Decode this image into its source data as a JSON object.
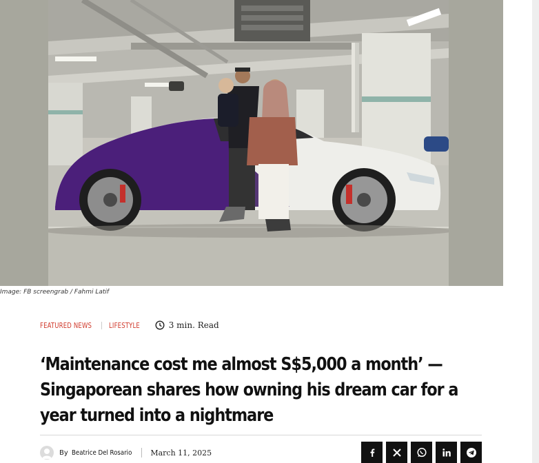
{
  "caption": "Image: FB screengrab / Fahmi Latif",
  "categories": [
    {
      "label": "FEATURED NEWS",
      "color": "#d0392b"
    },
    {
      "label": "LIFESTYLE",
      "color": "#d0392b"
    }
  ],
  "read_time": "3 min. Read",
  "headline": "‘Maintenance cost me almost S$5,000 a month’ — Singaporean shares how owning his dream car for a year turned into a nightmare",
  "byline": {
    "by": "By",
    "author": "Beatrice Del Rosario",
    "date": "March 11, 2025"
  },
  "share": [
    {
      "name": "facebook",
      "icon": "facebook-icon"
    },
    {
      "name": "x",
      "icon": "x-icon"
    },
    {
      "name": "whatsapp",
      "icon": "whatsapp-icon"
    },
    {
      "name": "linkedin",
      "icon": "linkedin-icon"
    },
    {
      "name": "telegram",
      "icon": "telegram-icon"
    }
  ],
  "colors": {
    "accent": "#d0392b",
    "share_bg": "#111111",
    "car_purple": "#4b1f7a",
    "car_white": "#eeeeee"
  }
}
